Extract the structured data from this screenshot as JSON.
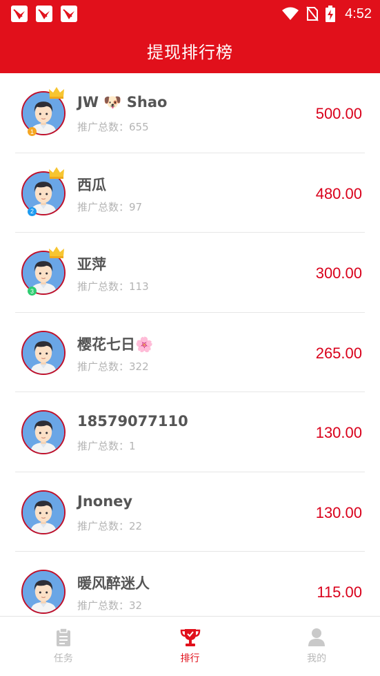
{
  "status_bar": {
    "time": "4:52",
    "notification_icons": [
      "app-notification-icon",
      "app-notification-icon",
      "app-notification-icon"
    ],
    "system_icons": [
      "wifi-icon",
      "no-sim-icon",
      "battery-charging-icon"
    ]
  },
  "header": {
    "title": "提现排行榜"
  },
  "colors": {
    "brand": "#e1101b",
    "amount": "#d9001b",
    "rank1": "#f5a623",
    "rank2": "#1e9bf0",
    "rank3": "#2ecc71"
  },
  "ranking": [
    {
      "name": "JW 🐶 Shao",
      "sub": "推广总数：655",
      "amount": "500.00",
      "rank": "1",
      "crown": true
    },
    {
      "name": "西瓜",
      "sub": "推广总数：97",
      "amount": "480.00",
      "rank": "2",
      "crown": true
    },
    {
      "name": "亚萍",
      "sub": "推广总数：113",
      "amount": "300.00",
      "rank": "3",
      "crown": true
    },
    {
      "name": "樱花七日🌸",
      "sub": "推广总数：322",
      "amount": "265.00",
      "rank": "",
      "crown": false
    },
    {
      "name": "18579077110",
      "sub": "推广总数：1",
      "amount": "130.00",
      "rank": "",
      "crown": false
    },
    {
      "name": "Jnoney",
      "sub": "推广总数：22",
      "amount": "130.00",
      "rank": "",
      "crown": false
    },
    {
      "name": "暖风醉迷人",
      "sub": "推广总数：32",
      "amount": "115.00",
      "rank": "",
      "crown": false
    }
  ],
  "tabs": [
    {
      "label": "任务",
      "icon": "clipboard-icon",
      "active": false
    },
    {
      "label": "排行",
      "icon": "trophy-icon",
      "active": true
    },
    {
      "label": "我的",
      "icon": "person-icon",
      "active": false
    }
  ]
}
